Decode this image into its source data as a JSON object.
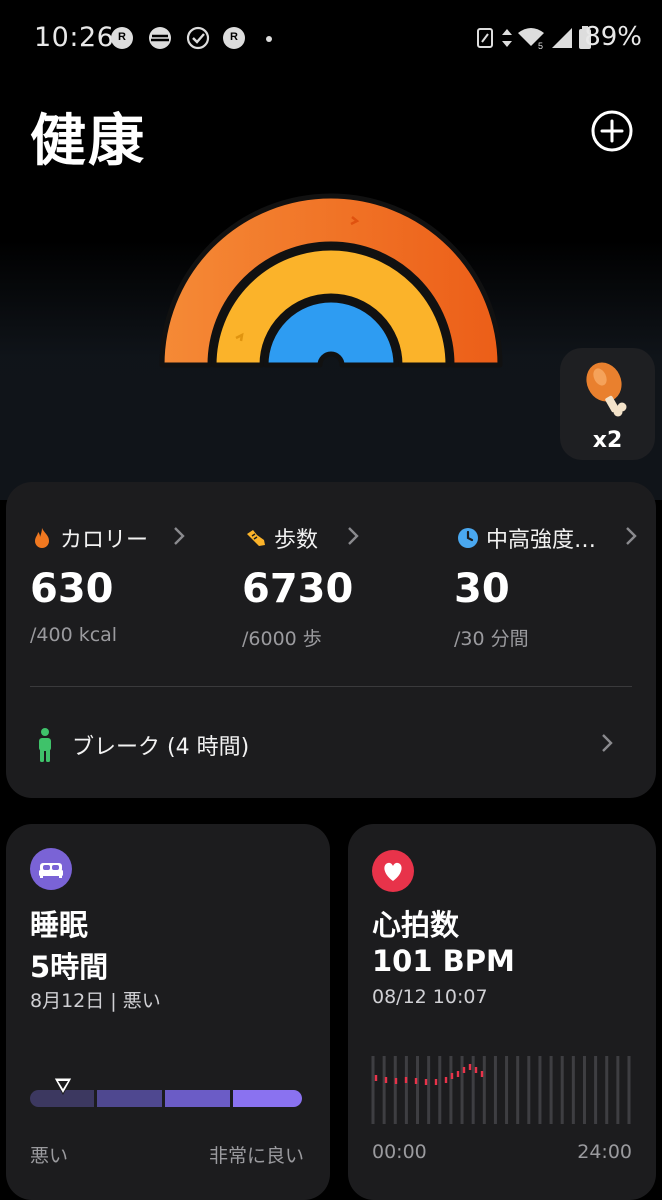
{
  "status_bar": {
    "time": "10:26",
    "battery": "89%",
    "notification_icons": [
      "rakuten-link-icon",
      "tracker-icon",
      "check-icon",
      "rakuten-link-icon"
    ],
    "system_icons": [
      "nfc-icon",
      "data-arrows-icon",
      "wifi-icon",
      "signal-icon",
      "battery-icon"
    ]
  },
  "header": {
    "title": "健康",
    "add_icon": "plus-circle-icon"
  },
  "rings": {
    "colors": {
      "outer": "#F07820",
      "middle": "#FBB32A",
      "inner": "#2E9CF2"
    }
  },
  "badge": {
    "multiplier": "x2",
    "icon": "drumstick-icon"
  },
  "summary": {
    "stats": [
      {
        "icon": "flame-icon",
        "label": "カロリー",
        "value": "630",
        "goal": "/400 kcal",
        "color": "#F07820"
      },
      {
        "icon": "shoe-icon",
        "label": "歩数",
        "value": "6730",
        "goal": "/6000 歩",
        "color": "#FBB32A"
      },
      {
        "icon": "clock-icon",
        "label": "中高強度…",
        "value": "30",
        "goal": "/30 分間",
        "color": "#4AA8F0"
      }
    ],
    "break": {
      "icon": "person-standing-icon",
      "label": "ブレーク (4 時間)"
    }
  },
  "sleep": {
    "icon": "bed-icon",
    "title": "睡眠",
    "value": "5時間",
    "date": "8月12日 | 悪い",
    "quality_fraction": 0.12,
    "scale_left": "悪い",
    "scale_right": "非常に良い"
  },
  "heart": {
    "icon": "heart-icon",
    "title": "心拍数",
    "value": "101 BPM",
    "timestamp": "08/12 10:07",
    "axis_start": "00:00",
    "axis_end": "24:00"
  }
}
